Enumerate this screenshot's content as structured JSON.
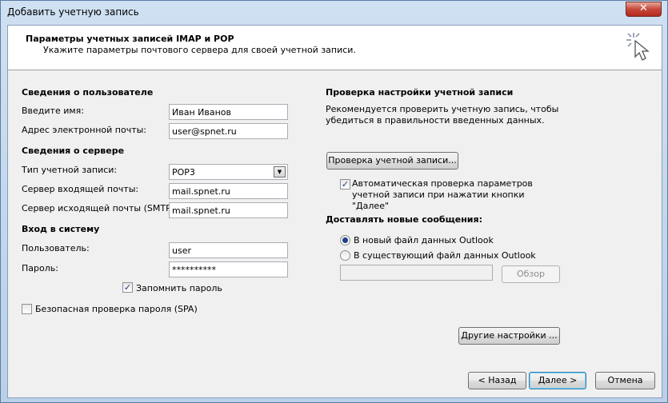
{
  "window": {
    "title": "Добавить учетную запись",
    "close_label": "✕"
  },
  "header": {
    "title": "Параметры учетных записей IMAP и POP",
    "subtitle": "Укажите параметры почтового сервера для своей учетной записи."
  },
  "user_info": {
    "heading": "Сведения о пользователе",
    "name_label": "Введите имя:",
    "name_value": "Иван Иванов",
    "email_label": "Адрес электронной почты:",
    "email_value": "user@spnet.ru"
  },
  "server_info": {
    "heading": "Сведения о сервере",
    "account_type_label": "Тип учетной записи:",
    "account_type_value": "POP3",
    "incoming_label": "Сервер входящей почты:",
    "incoming_value": "mail.spnet.ru",
    "outgoing_label": "Сервер исходящей почты (SMTP):",
    "outgoing_value": "mail.spnet.ru"
  },
  "login": {
    "heading": "Вход в систему",
    "user_label": "Пользователь:",
    "user_value": "user",
    "password_label": "Пароль:",
    "password_value": "**********",
    "remember_label": "Запомнить пароль",
    "remember_checked": true
  },
  "spa": {
    "label": "Безопасная проверка пароля (SPA)",
    "checked": false
  },
  "test": {
    "heading": "Проверка настройки учетной записи",
    "description_line1": "Рекомендуется проверить учетную запись, чтобы",
    "description_line2": "убедиться в правильности введенных данных.",
    "button_label": "Проверка учетной записи...",
    "auto_line1": "Автоматическая проверка параметров",
    "auto_line2": "учетной записи при нажатии кнопки",
    "auto_line3": "\"Далее\"",
    "auto_checked": true
  },
  "delivery": {
    "heading": "Доставлять новые сообщения:",
    "option_new": "В новый файл данных Outlook",
    "option_existing": "В существующий файл данных Outlook",
    "selected": "new",
    "path_value": "",
    "browse_label": "Обзор"
  },
  "more_settings_label": "Другие настройки ...",
  "footer": {
    "back_label": "< Назад",
    "next_label": "Далее >",
    "cancel_label": "Отмена"
  }
}
